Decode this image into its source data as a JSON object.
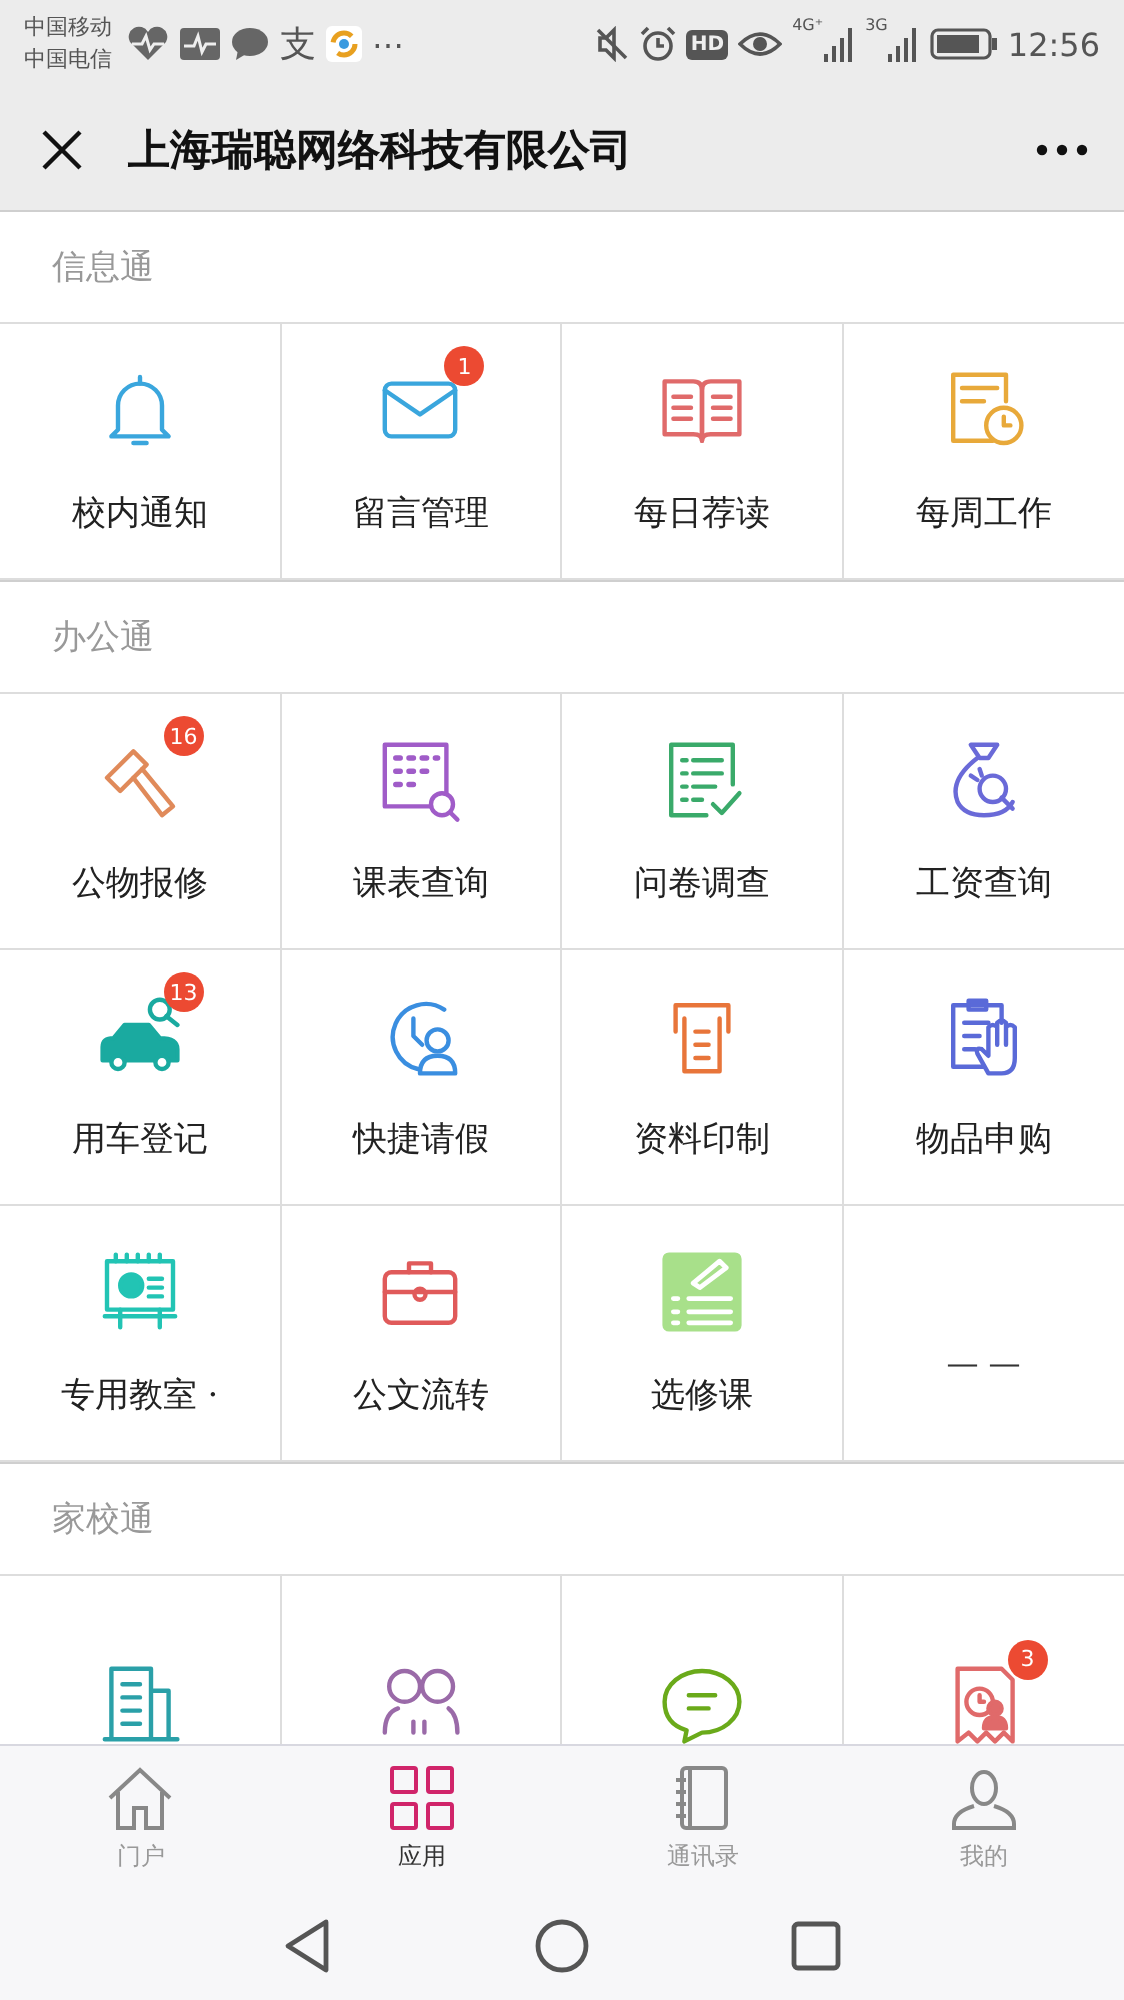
{
  "status_bar": {
    "carriers": [
      "中国移动",
      "中国电信"
    ],
    "app_glyph": "支",
    "overflow": "⋯",
    "hd": "HD",
    "networks": [
      "4G⁺",
      "3G"
    ],
    "time": "12:56"
  },
  "nav": {
    "title": "上海瑞聪网络科技有限公司"
  },
  "sections": [
    {
      "title": "信息通",
      "items": [
        {
          "label": "校内通知",
          "kind": "bell"
        },
        {
          "label": "留言管理",
          "kind": "mail",
          "badge": "1"
        },
        {
          "label": "每日荐读",
          "kind": "book"
        },
        {
          "label": "每周工作",
          "kind": "calendar"
        }
      ]
    },
    {
      "title": "办公通",
      "items": [
        {
          "label": "公物报修",
          "kind": "hammer",
          "badge": "16"
        },
        {
          "label": "课表查询",
          "kind": "gridsearch"
        },
        {
          "label": "问卷调查",
          "kind": "checklist"
        },
        {
          "label": "工资查询",
          "kind": "moneybag"
        },
        {
          "label": "用车登记",
          "kind": "car",
          "badge": "13"
        },
        {
          "label": "快捷请假",
          "kind": "clockperson"
        },
        {
          "label": "资料印制",
          "kind": "printer"
        },
        {
          "label": "物品申购",
          "kind": "clipboardhand"
        },
        {
          "label": "专用教室 ·",
          "kind": "easel"
        },
        {
          "label": "公文流转",
          "kind": "briefcase"
        },
        {
          "label": "选修课",
          "kind": "notepad"
        },
        {
          "label": "— —",
          "kind": "blank"
        }
      ]
    },
    {
      "title": "家校通",
      "items": [
        {
          "kind": "building"
        },
        {
          "kind": "people"
        },
        {
          "kind": "chat"
        },
        {
          "kind": "receipt",
          "badge": "3"
        }
      ]
    }
  ],
  "tabs": [
    {
      "label": "门户",
      "kind": "home",
      "selected": false
    },
    {
      "label": "应用",
      "kind": "apps",
      "selected": true
    },
    {
      "label": "通讯录",
      "kind": "contacts",
      "selected": false
    },
    {
      "label": "我的",
      "kind": "profile",
      "selected": false
    }
  ]
}
